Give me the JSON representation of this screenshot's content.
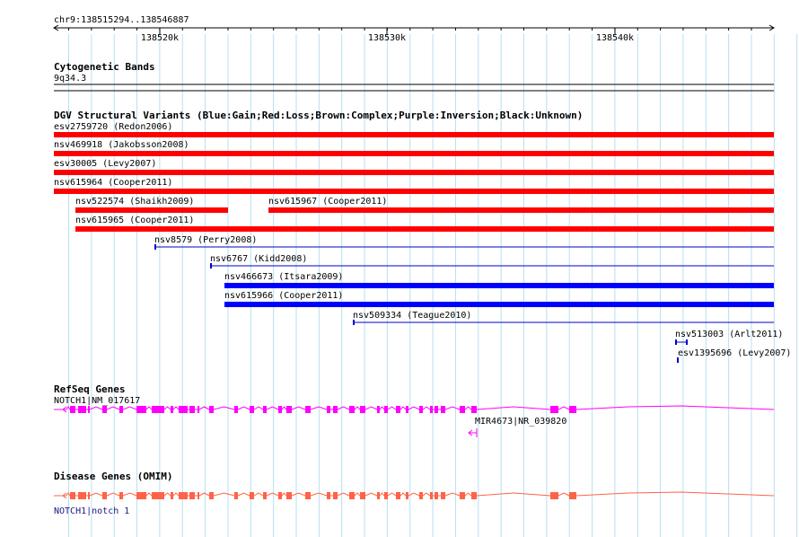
{
  "ruler": {
    "location": "chr9:138515294..138546887",
    "ticks": [
      "138520k",
      "138530k",
      "138540k"
    ]
  },
  "cytoband": {
    "title": "Cytogenetic Bands",
    "band": "9q34.3"
  },
  "dgv": {
    "title": "DGV Structural Variants (Blue:Gain;Red:Loss;Brown:Complex;Purple:Inversion;Black:Unknown)",
    "colors": {
      "loss": "#ff0000",
      "gain": "#0000ff",
      "line": "#0000cc"
    },
    "variants": [
      {
        "label": "esv2759720 (Redon2006)",
        "type": "loss"
      },
      {
        "label": "nsv469918 (Jakobsson2008)",
        "type": "loss"
      },
      {
        "label": "esv30005 (Levy2007)",
        "type": "loss"
      },
      {
        "label": "nsv615964 (Cooper2011)",
        "type": "loss"
      },
      {
        "label": "nsv522574 (Shaikh2009)",
        "type": "loss"
      },
      {
        "label": "nsv615967 (Cooper2011)",
        "type": "loss"
      },
      {
        "label": "nsv615965 (Cooper2011)",
        "type": "loss"
      },
      {
        "label": "nsv8579 (Perry2008)",
        "type": "gain"
      },
      {
        "label": "nsv6767 (Kidd2008)",
        "type": "gain"
      },
      {
        "label": "nsv466673 (Itsara2009)",
        "type": "gain"
      },
      {
        "label": "nsv615966 (Cooper2011)",
        "type": "gain"
      },
      {
        "label": "nsv509334 (Teague2010)",
        "type": "gain"
      },
      {
        "label": "nsv513003 (Arlt2011)",
        "type": "gain"
      },
      {
        "label": "esv1395696 (Levy2007)",
        "type": "gain"
      }
    ]
  },
  "refseq": {
    "title": "RefSeq Genes",
    "color": "#ff00ff",
    "genes": [
      {
        "label": "NOTCH1|NM_017617"
      },
      {
        "label": "MIR4673|NR_039820"
      }
    ]
  },
  "omim": {
    "title": "Disease Genes (OMIM)",
    "color": "#ff6347",
    "genes": [
      {
        "label": "NOTCH1|notch 1"
      }
    ]
  }
}
